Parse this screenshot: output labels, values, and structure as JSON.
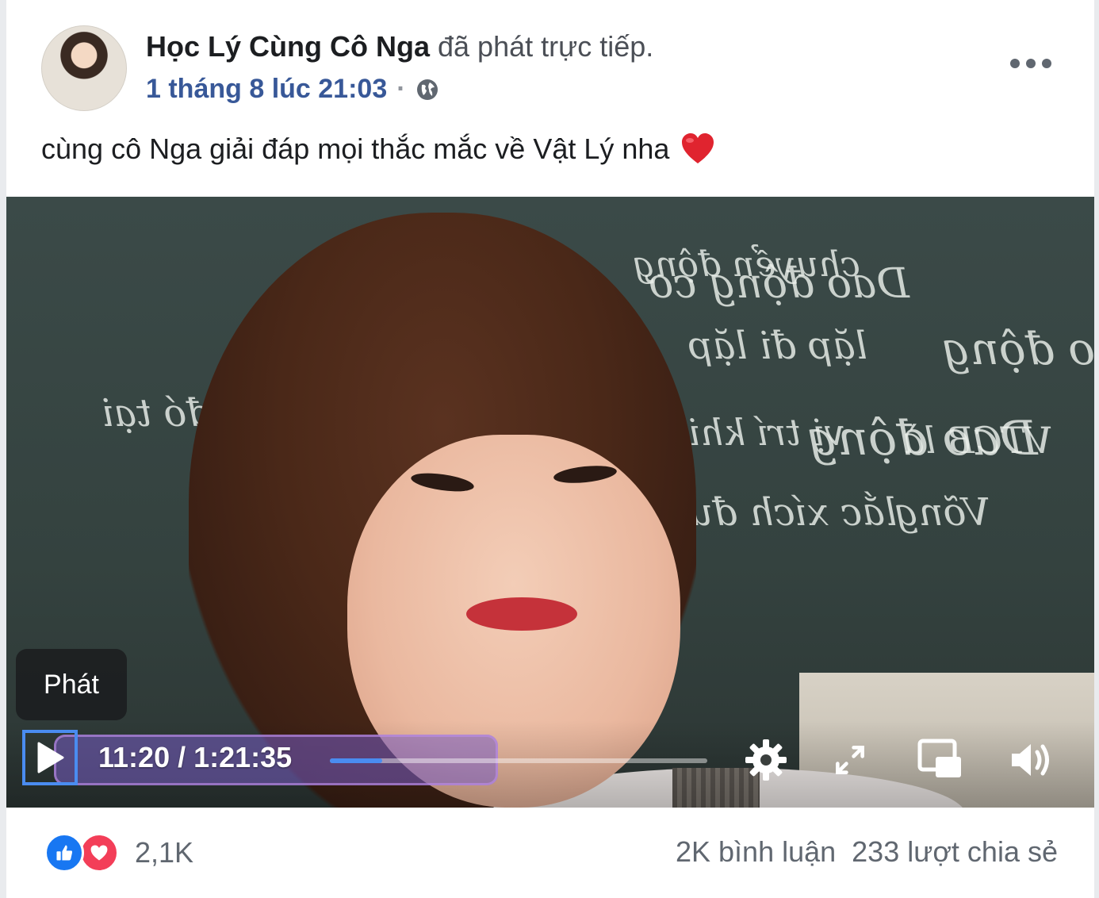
{
  "post": {
    "author": "Học Lý Cùng Cô Nga",
    "action": "đã phát trực tiếp.",
    "timestamp": "1 tháng 8 lúc 21:03",
    "separator": "·",
    "privacy_icon": "globe-icon",
    "more_icon": "ellipsis-icon",
    "text": "cùng cô Nga giải đáp mọi thắc mắc về Vật Lý nha",
    "emoji": "heart-emoji"
  },
  "video": {
    "tooltip": "Phát",
    "current_time": "11:20",
    "duration": "1:21:35",
    "time_separator": " / ",
    "progress_fraction": 0.139,
    "accent_color": "#4a8cf0",
    "controls": {
      "play_icon": "play-icon",
      "settings_icon": "gear-icon",
      "fullscreen_icon": "expand-icon",
      "pip_icon": "picture-in-picture-icon",
      "volume_icon": "volume-icon"
    }
  },
  "footer": {
    "reaction_count": "2,1K",
    "comments": "2K bình luận",
    "shares": "233 lượt chia sẻ",
    "reaction_icons": [
      "like-icon",
      "love-icon"
    ]
  }
}
